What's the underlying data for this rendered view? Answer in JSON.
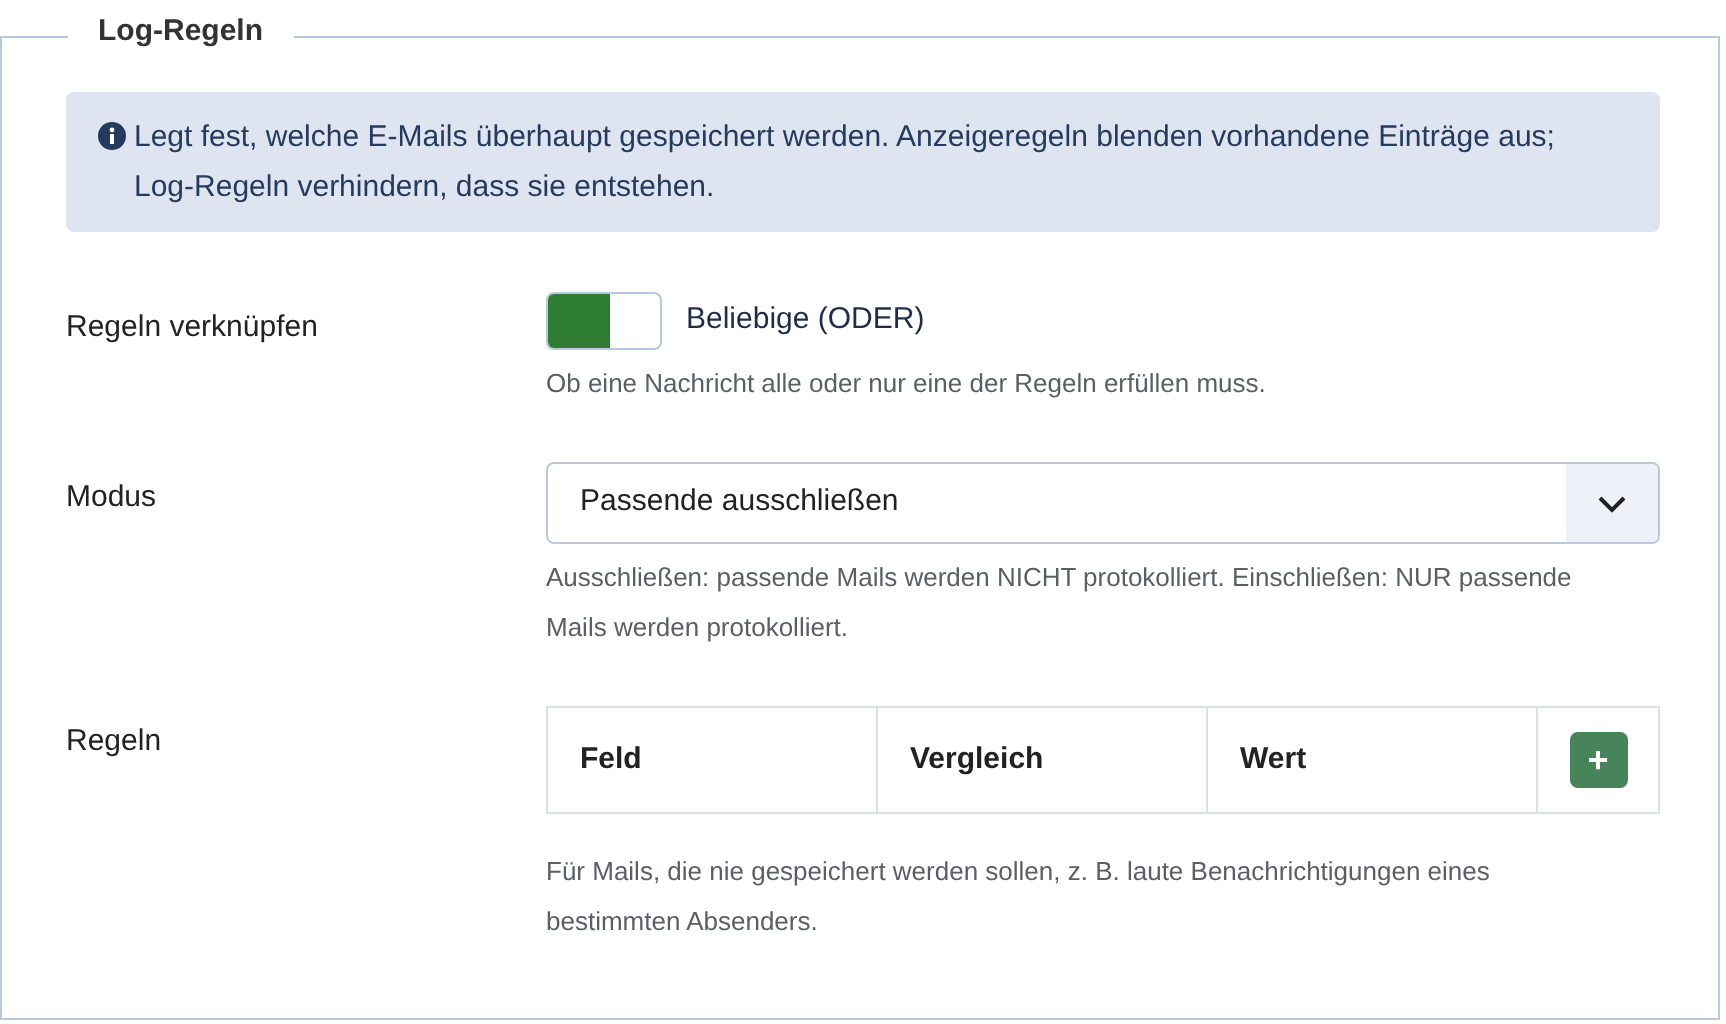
{
  "section": {
    "title": "Log-Regeln"
  },
  "info": {
    "text": "Legt fest, welche E-Mails überhaupt gespeichert werden. Anzeigeregeln blenden vorhandene Einträge aus; Log-Regeln verhindern, dass sie entstehen."
  },
  "fields": [
    {
      "kind": "toggle",
      "label": "Regeln verknüpfen",
      "on": true,
      "value": "Beliebige (ODER)",
      "help": "Ob eine Nachricht alle oder nur eine der Regeln erfüllen muss."
    },
    {
      "kind": "select",
      "label": "Modus",
      "value": "Passende ausschließen",
      "help": "Ausschließen: passende Mails werden NICHT protokolliert. Einschließen: NUR passende Mails werden protokolliert."
    },
    {
      "kind": "table",
      "label": "Regeln",
      "columns": [
        "Feld",
        "Vergleich",
        "Wert"
      ],
      "add_button": "+",
      "help": "Für Mails, die nie gespeichert werden sollen, z. B. laute Benachrichtigungen eines bestimmten Absenders."
    }
  ]
}
